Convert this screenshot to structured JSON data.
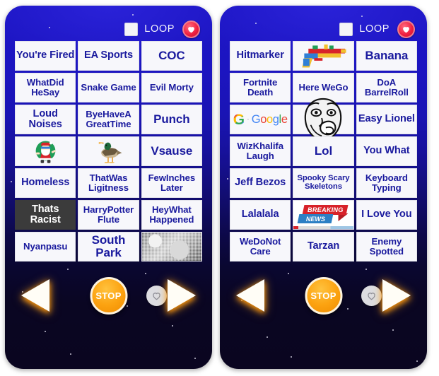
{
  "app": {
    "header": {
      "loop_label": "LOOP",
      "loop_checked": false,
      "favorite_icon": "heart-icon"
    },
    "controls": {
      "prev_label": "",
      "stop_label": "STOP",
      "favorite_label": "",
      "next_label": ""
    },
    "colors": {
      "panel_top": "#1e16c6",
      "panel_bottom": "#0a0520",
      "cell_bg": "#f7f7fb",
      "cell_text": "#1a1a9e",
      "cell_dark_bg": "#3b3b3b",
      "accent_orange": "#fca311",
      "heart_red": "#ef1f3f"
    }
  },
  "panels": [
    {
      "id": "panel-left",
      "buttons": [
        {
          "label": "You're Fired",
          "type": "text",
          "size": "md"
        },
        {
          "label": "EA Sports",
          "type": "text",
          "size": "md"
        },
        {
          "label": "COC",
          "type": "text",
          "size": "lg"
        },
        {
          "label": "WhatDid HeSay",
          "type": "text",
          "size": "reg"
        },
        {
          "label": "Snake Game",
          "type": "text",
          "size": "reg"
        },
        {
          "label": "Evil Morty",
          "type": "text",
          "size": "reg"
        },
        {
          "label": "Loud Noises",
          "type": "text",
          "size": "md"
        },
        {
          "label": "ByeHaveA GreatTime",
          "type": "text",
          "size": "reg"
        },
        {
          "label": "Punch",
          "type": "text",
          "size": "lg"
        },
        {
          "label": "Santa",
          "type": "image",
          "image": "santa-image"
        },
        {
          "label": "Duck",
          "type": "image",
          "image": "duck-image"
        },
        {
          "label": "Vsause",
          "type": "text",
          "size": "lg"
        },
        {
          "label": "Homeless",
          "type": "text",
          "size": "md"
        },
        {
          "label": "ThatWas Ligitness",
          "type": "text",
          "size": "reg"
        },
        {
          "label": "FewInches Later",
          "type": "text",
          "size": "reg"
        },
        {
          "label": "Thats Racist",
          "type": "text",
          "size": "md",
          "dark": true
        },
        {
          "label": "HarryPotter Flute",
          "type": "text",
          "size": "reg"
        },
        {
          "label": "HeyWhat Happened",
          "type": "text",
          "size": "reg"
        },
        {
          "label": "Nyanpasu",
          "type": "text",
          "size": "reg"
        },
        {
          "label": "South Park",
          "type": "text",
          "size": "lg"
        },
        {
          "label": "Static",
          "type": "image",
          "image": "static-noise-image"
        }
      ]
    },
    {
      "id": "panel-right",
      "buttons": [
        {
          "label": "Hitmarker",
          "type": "text",
          "size": "md"
        },
        {
          "label": "Gun",
          "type": "image",
          "image": "lego-gun-image"
        },
        {
          "label": "Banana",
          "type": "text",
          "size": "lg"
        },
        {
          "label": "Fortnite Death",
          "type": "text",
          "size": "reg"
        },
        {
          "label": "Here WeGo",
          "type": "text",
          "size": "reg"
        },
        {
          "label": "DoA BarrelRoll",
          "type": "text",
          "size": "reg"
        },
        {
          "label": "Google",
          "type": "image",
          "image": "google-logo-image"
        },
        {
          "label": "TrollFace",
          "type": "image",
          "image": "troll-face-image"
        },
        {
          "label": "Easy Lionel",
          "type": "text",
          "size": "md"
        },
        {
          "label": "WizKhalifa Laugh",
          "type": "text",
          "size": "reg"
        },
        {
          "label": "Lol",
          "type": "text",
          "size": "lg"
        },
        {
          "label": "You What",
          "type": "text",
          "size": "md"
        },
        {
          "label": "Jeff Bezos",
          "type": "text",
          "size": "md"
        },
        {
          "label": "Spooky Scary Skeletons",
          "type": "text",
          "size": "sm"
        },
        {
          "label": "Keyboard Typing",
          "type": "text",
          "size": "reg"
        },
        {
          "label": "Lalalala",
          "type": "text",
          "size": "md"
        },
        {
          "label": "Breaking News",
          "type": "image",
          "image": "breaking-news-image"
        },
        {
          "label": "I Love You",
          "type": "text",
          "size": "md"
        },
        {
          "label": "WeDoNot Care",
          "type": "text",
          "size": "reg"
        },
        {
          "label": "Tarzan",
          "type": "text",
          "size": "md"
        },
        {
          "label": "Enemy Spotted",
          "type": "text",
          "size": "reg"
        }
      ]
    }
  ]
}
